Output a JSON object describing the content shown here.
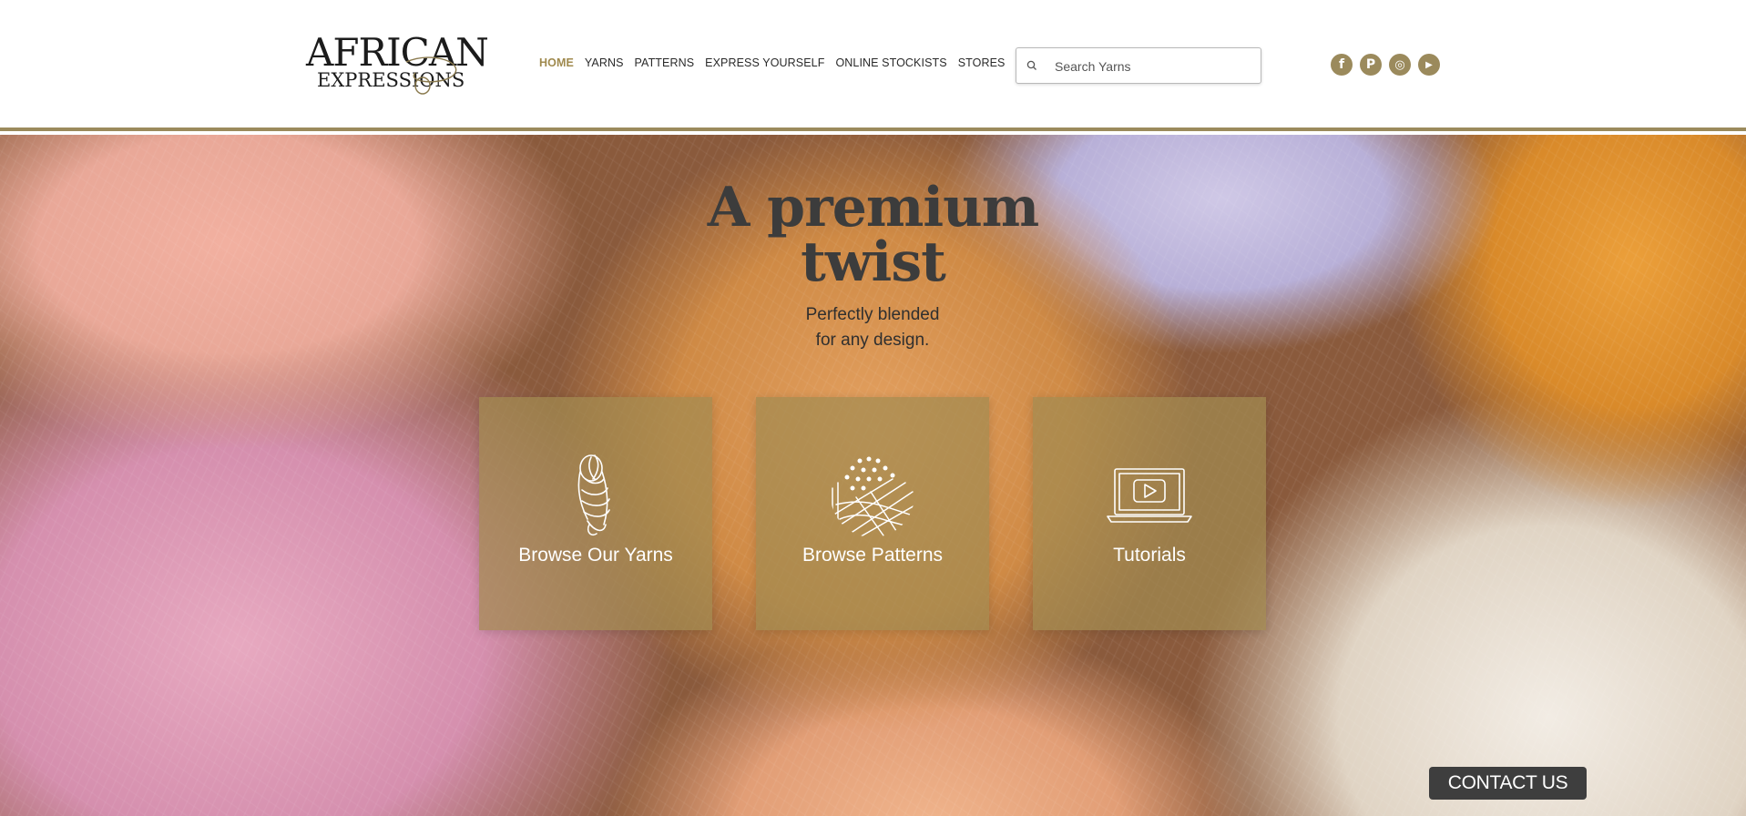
{
  "logo": {
    "line1": "AFRICAN",
    "line2": "EXPRESSIONS"
  },
  "nav": {
    "items": [
      {
        "label": "HOME",
        "active": true
      },
      {
        "label": "YARNS"
      },
      {
        "label": "PATTERNS"
      },
      {
        "label": "EXPRESS YOURSELF"
      },
      {
        "label": "ONLINE STOCKISTS"
      },
      {
        "label": "STORES"
      }
    ]
  },
  "search": {
    "placeholder": "Search Yarns",
    "icon": "search-icon"
  },
  "social": [
    {
      "name": "facebook-icon",
      "glyph": "f"
    },
    {
      "name": "pinterest-icon",
      "glyph": "P"
    },
    {
      "name": "instagram-icon",
      "glyph": "◎"
    },
    {
      "name": "youtube-icon",
      "glyph": "▶"
    }
  ],
  "hero": {
    "headline_line1": "A premium",
    "headline_line2": "twist",
    "sub_line1": "Perfectly blended",
    "sub_line2": "for any design."
  },
  "cards": [
    {
      "label": "Browse Our Yarns",
      "icon": "yarn-skein-icon"
    },
    {
      "label": "Browse Patterns",
      "icon": "pattern-weave-icon"
    },
    {
      "label": "Tutorials",
      "icon": "laptop-video-icon"
    }
  ],
  "contact": {
    "label": "CONTACT US"
  },
  "colors": {
    "accent": "#9b8a5c",
    "nav_active": "#a08a4e",
    "card_bg": "#a28a50",
    "contact_bg": "#3e3e3e"
  }
}
